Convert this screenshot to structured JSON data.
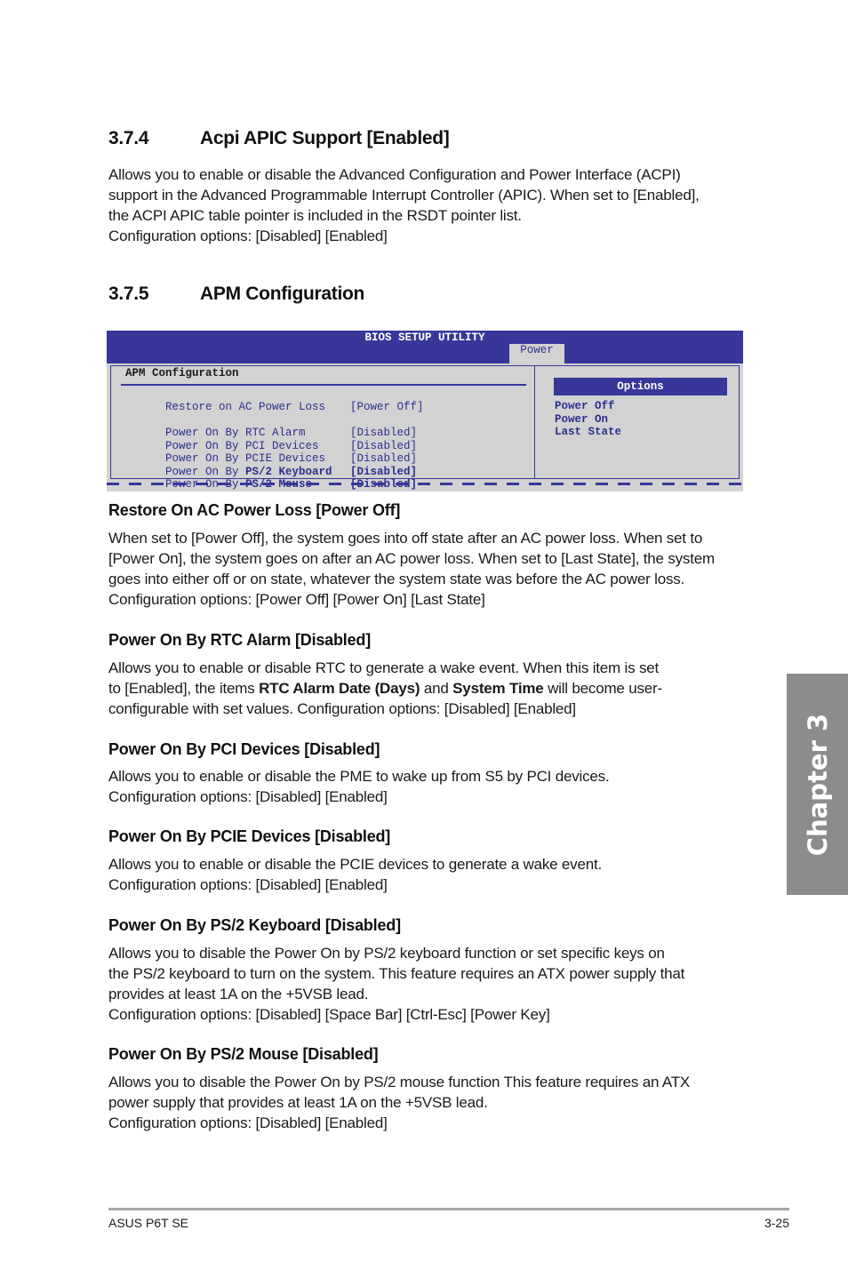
{
  "sections": [
    {
      "number": "3.7.4",
      "title": "Acpi APIC Support [Enabled]",
      "paragraph": [
        "Allows you to enable or disable the Advanced Configuration and Power Interface (ACPI)",
        "support in the Advanced Programmable Interrupt Controller (APIC). When set to [Enabled],",
        "the ACPI APIC table pointer is included in the RSDT pointer list.",
        "Configuration options: [Disabled] [Enabled]"
      ]
    },
    {
      "number": "3.7.5",
      "title": "APM Configuration"
    }
  ],
  "bios": {
    "title": "BIOS SETUP UTILITY",
    "active_tab": "Power",
    "section_label": "APM Configuration",
    "items": [
      {
        "label": "Restore on AC Power Loss",
        "value": "[Power Off]"
      },
      {
        "label": "Power On By RTC Alarm",
        "value": "[Disabled]"
      },
      {
        "label": "Power On By PCI Devices",
        "value": "[Disabled]"
      },
      {
        "label": "Power On By PCIE Devices",
        "value": "[Disabled]"
      },
      {
        "label_prefix": "Power On By ",
        "label_bold": "PS/2 Keyboard",
        "value": "[Disabled]"
      },
      {
        "label_prefix": "Power On By ",
        "label_bold": "PS/2 Mouse",
        "value": "[Disabled]"
      }
    ],
    "options_header": "Options",
    "options": [
      "Power Off",
      "Power On",
      "Last State"
    ]
  },
  "subsections": [
    {
      "title": "Restore On AC Power Loss [Power Off]",
      "lines": [
        "When set to [Power Off], the system goes into off state after an AC power loss. When set to",
        "[Power On], the system goes on after an AC power loss. When set to [Last State], the system",
        "goes into either off or on state, whatever the system state was before the AC power loss.",
        "Configuration options: [Power Off] [Power On] [Last State]"
      ]
    },
    {
      "title": "Power On By RTC Alarm [Disabled]",
      "line1": "Allows you to enable or disable RTC to generate a wake event. When this item is set",
      "line2_a": "to [Enabled], the items ",
      "line2_b": "RTC Alarm Date (Days)",
      "line2_c": " and ",
      "line2_d": "System Time",
      "line2_e": " will become user-",
      "line3": "configurable with set values. Configuration options: [Disabled] [Enabled]"
    },
    {
      "title": "Power On By PCI Devices [Disabled]",
      "lines": [
        "Allows you to enable or disable the PME to wake up from S5 by PCI devices.",
        "Configuration options: [Disabled] [Enabled]"
      ]
    },
    {
      "title": "Power On By PCIE Devices [Disabled]",
      "lines": [
        "Allows you to enable or disable the PCIE devices to generate a wake event.",
        "Configuration options: [Disabled] [Enabled]"
      ]
    },
    {
      "title": "Power On By PS/2 Keyboard [Disabled]",
      "lines": [
        "Allows you to disable the Power On by PS/2 keyboard function or set specific keys on",
        "the PS/2 keyboard to turn on the system. This feature requires an ATX power supply that",
        "provides at least 1A on the +5VSB lead.",
        "Configuration options: [Disabled] [Space Bar] [Ctrl-Esc] [Power Key]"
      ]
    },
    {
      "title": "Power On By PS/2 Mouse [Disabled]",
      "lines": [
        "Allows you to disable the Power On by PS/2 mouse function This feature requires an ATX",
        "power supply that provides at least 1A on the +5VSB lead.",
        "Configuration options: [Disabled] [Enabled]"
      ]
    }
  ],
  "chapter_tab": "Chapter 3",
  "footer": {
    "left": "ASUS P6T SE",
    "right": "3-25"
  },
  "colors": {
    "bios_blue": "#37379a",
    "bios_gray": "#d2d2d2",
    "chapter_tab_gray": "#8c8c8c"
  }
}
